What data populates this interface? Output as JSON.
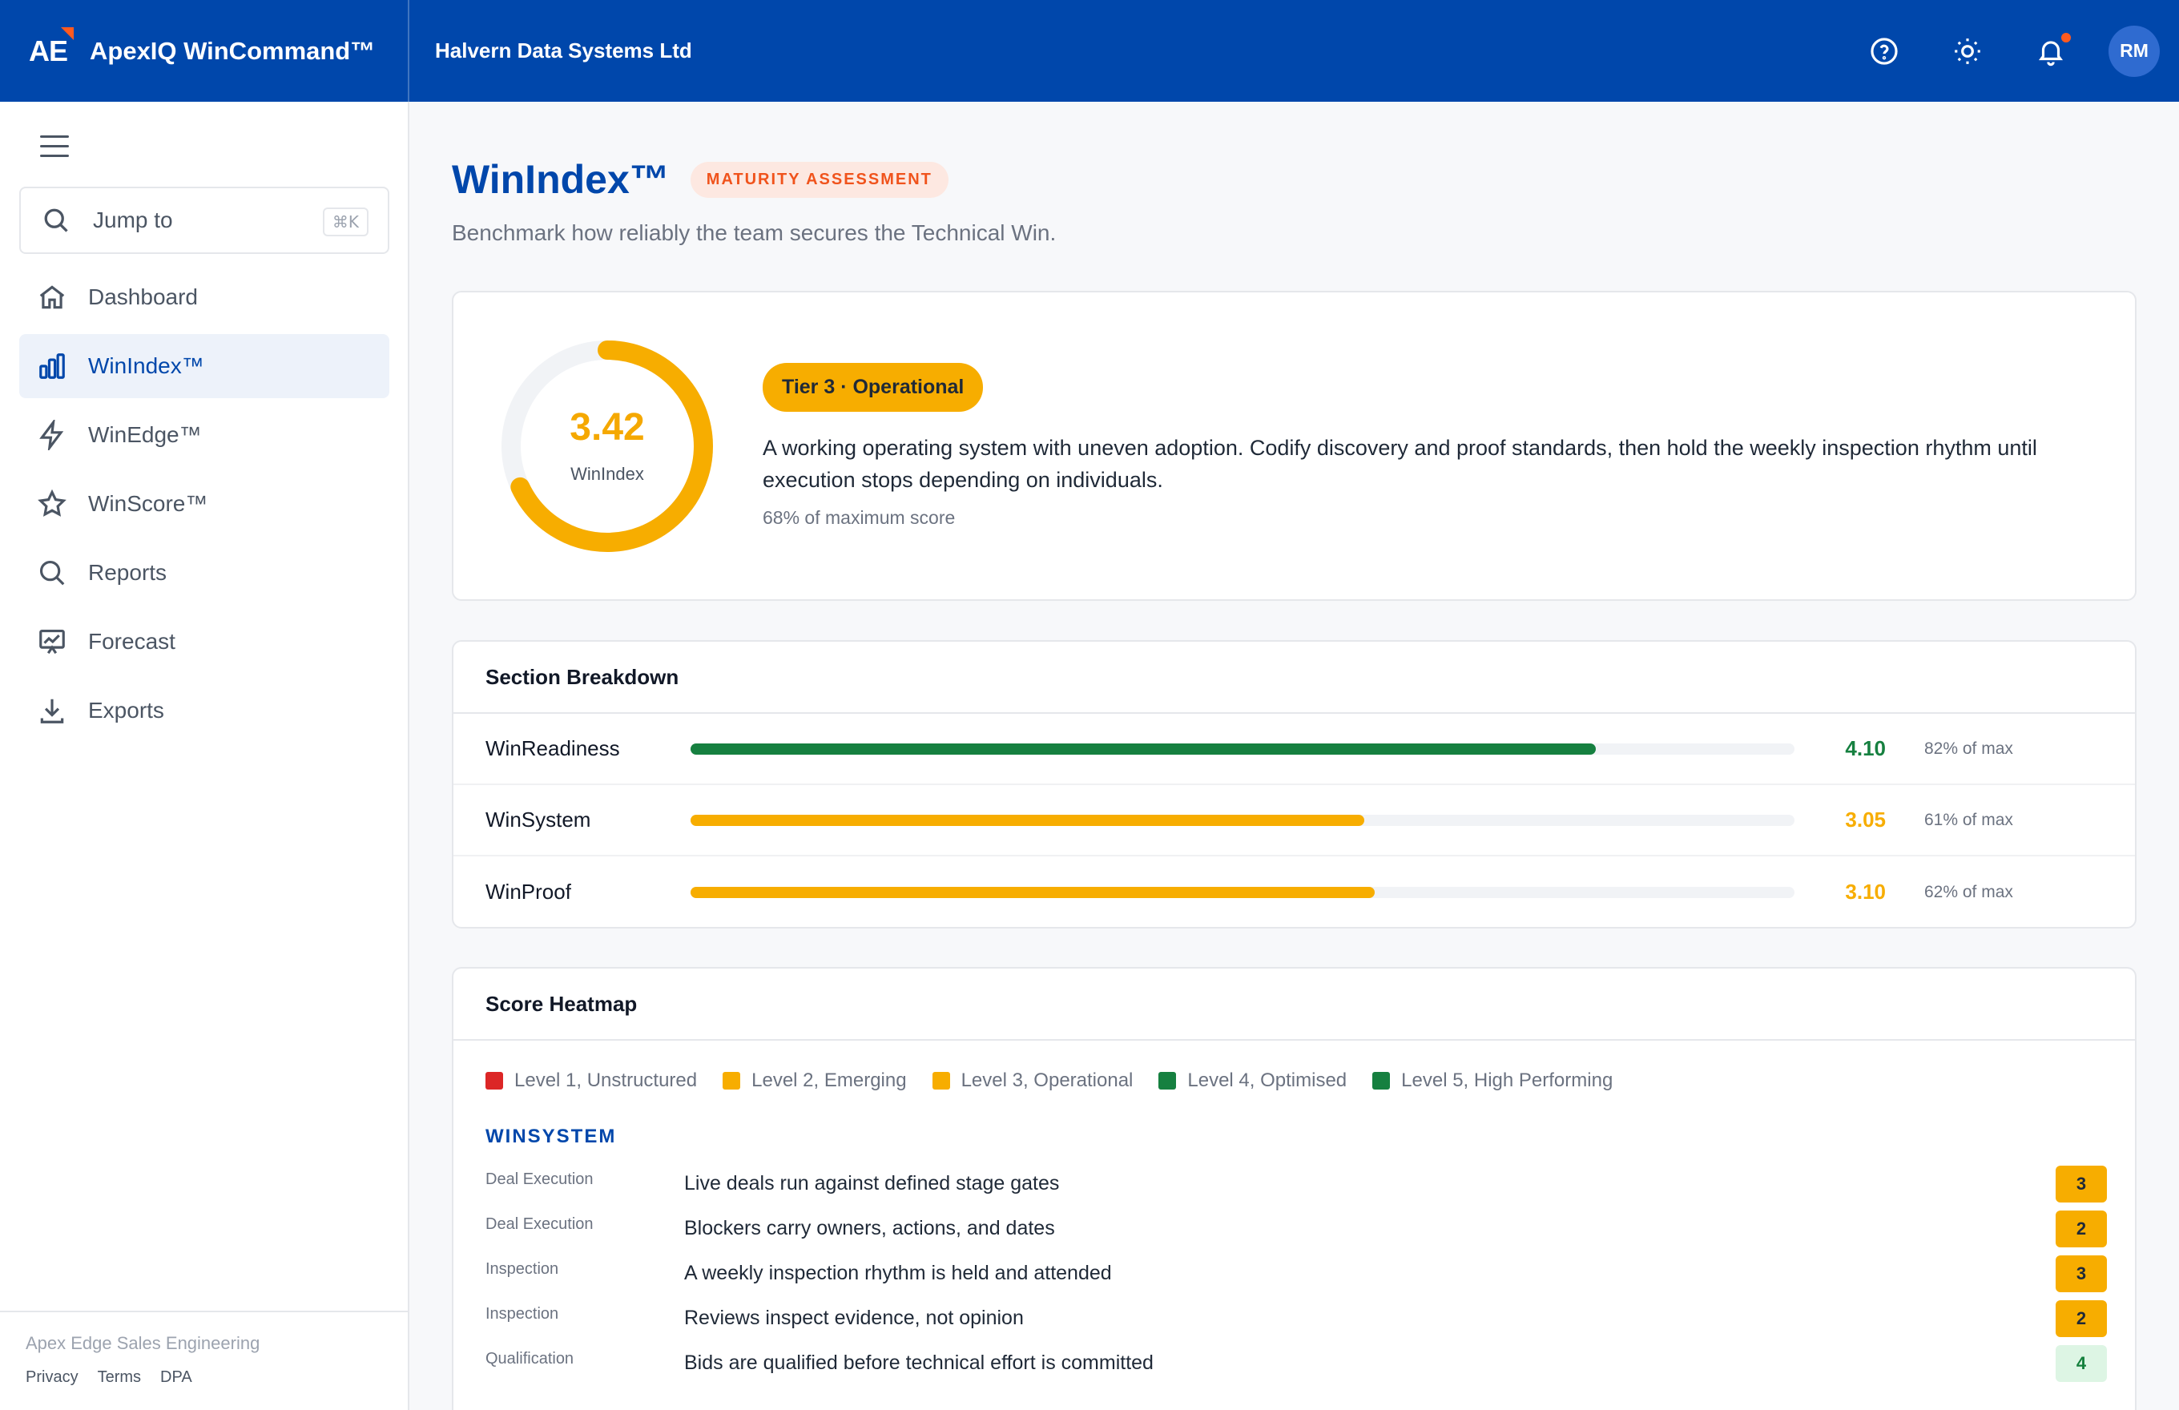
{
  "app": {
    "brand_initials": "AE",
    "brand_name": "ApexIQ WinCommand™",
    "org_name": "Halvern Data Systems Ltd",
    "user_initials": "RM",
    "accent": "#0047ab"
  },
  "sidebar": {
    "search_label": "Jump to",
    "search_shortcut": "⌘K",
    "items": [
      {
        "label": "Dashboard",
        "icon": "home-icon"
      },
      {
        "label": "WinIndex™",
        "icon": "bar-chart-icon",
        "active": true
      },
      {
        "label": "WinEdge™",
        "icon": "lightning-icon"
      },
      {
        "label": "WinScore™",
        "icon": "star-icon"
      },
      {
        "label": "Reports",
        "icon": "search-icon"
      },
      {
        "label": "Forecast",
        "icon": "presentation-chart-icon"
      },
      {
        "label": "Exports",
        "icon": "download-icon"
      }
    ],
    "footer": {
      "company": "Apex Edge Sales Engineering",
      "links": [
        "Privacy",
        "Terms",
        "DPA"
      ]
    }
  },
  "page": {
    "title": "WinIndex™",
    "badge": "MATURITY ASSESSMENT",
    "subtitle": "Benchmark how reliably the team secures the Technical Win."
  },
  "score": {
    "value": "3.42",
    "label": "WinIndex",
    "fraction": 0.68,
    "tier": "Tier 3 · Operational",
    "description": "A working operating system with uneven adoption. Codify discovery and proof standards, then hold the weekly inspection rhythm until execution stops depending on individuals.",
    "percent_text": "68% of maximum score",
    "color": "#f7ad00"
  },
  "breakdown": {
    "title": "Section Breakdown",
    "rows": [
      {
        "name": "WinReadiness",
        "score": "4.10",
        "fraction": 0.82,
        "pct_text": "82% of max",
        "color": "#168040"
      },
      {
        "name": "WinSystem",
        "score": "3.05",
        "fraction": 0.61,
        "pct_text": "61% of max",
        "color": "#f7ad00"
      },
      {
        "name": "WinProof",
        "score": "3.10",
        "fraction": 0.62,
        "pct_text": "62% of max",
        "color": "#f7ad00"
      }
    ]
  },
  "heatmap": {
    "title": "Score Heatmap",
    "legend": [
      {
        "label": "Level 1, Unstructured",
        "color": "#dc2626"
      },
      {
        "label": "Level 2, Emerging",
        "color": "#f7ad00"
      },
      {
        "label": "Level 3, Operational",
        "color": "#f7ad00"
      },
      {
        "label": "Level 4, Optimised",
        "color": "#168040"
      },
      {
        "label": "Level 5, High Performing",
        "color": "#168040"
      }
    ],
    "section": "WINSYSTEM",
    "rows": [
      {
        "category": "Deal Execution",
        "text": "Live deals run against defined stage gates",
        "score": "3"
      },
      {
        "category": "Deal Execution",
        "text": "Blockers carry owners, actions, and dates",
        "score": "2"
      },
      {
        "category": "Inspection",
        "text": "A weekly inspection rhythm is held and attended",
        "score": "3"
      },
      {
        "category": "Inspection",
        "text": "Reviews inspect evidence, not opinion",
        "score": "2"
      },
      {
        "category": "Qualification",
        "text": "Bids are qualified before technical effort is committed",
        "score": "4"
      }
    ]
  }
}
